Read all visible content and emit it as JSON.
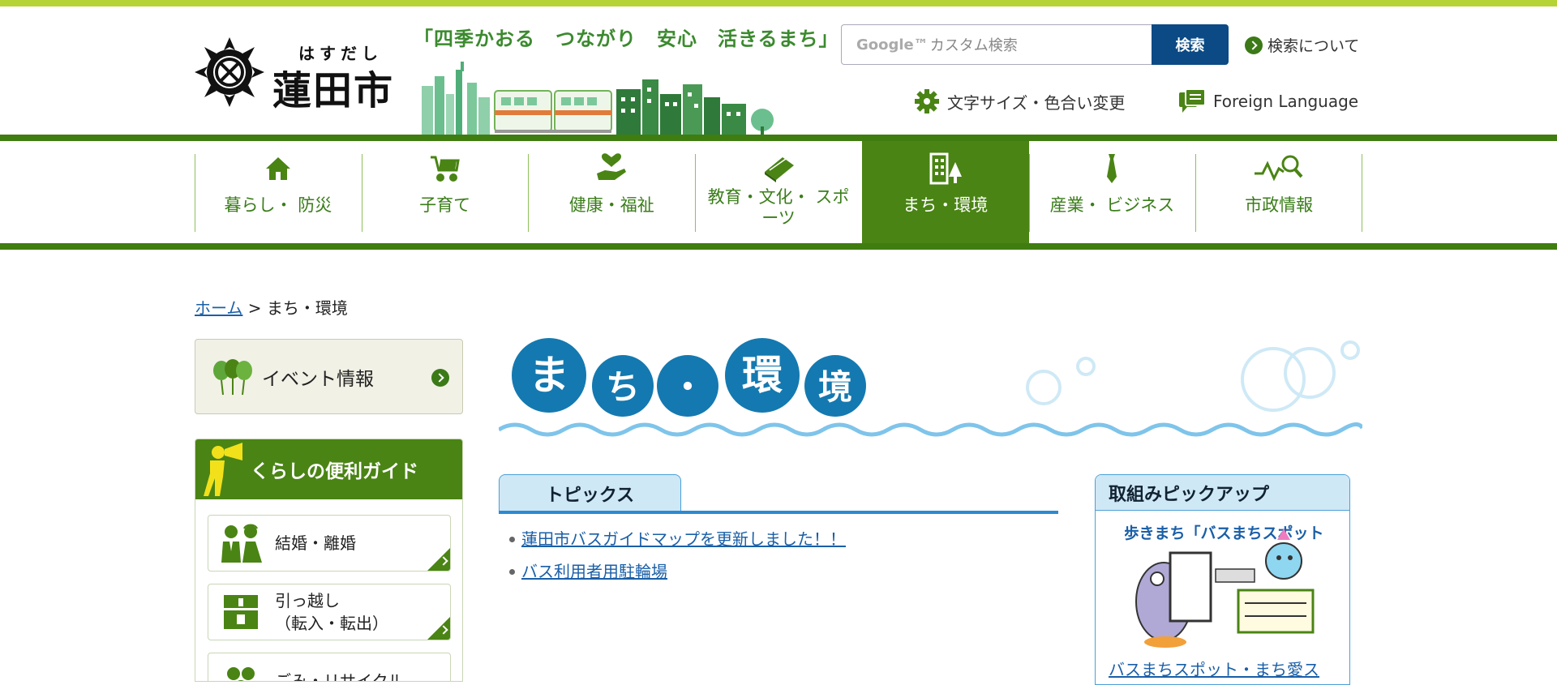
{
  "header": {
    "logo_kana": "はすだし",
    "logo_name": "蓮田市",
    "slogan": "「四季かおる　つながり　安心　活きるまち」",
    "search": {
      "placeholder_brand": "Google™",
      "placeholder_text": "カスタム検索",
      "button_label": "検索",
      "about_label": "検索について"
    },
    "textsize_label": "文字サイズ・色合い変更",
    "foreign_label": "Foreign Language"
  },
  "nav": {
    "items": [
      {
        "label": "暮らし・ 防災",
        "icon": "house-icon"
      },
      {
        "label": "子育て",
        "icon": "stroller-icon"
      },
      {
        "label": "健康・福祉",
        "icon": "heart-hand-icon"
      },
      {
        "label": "教育・文化・ スポーツ",
        "icon": "book-icon"
      },
      {
        "label": "まち・環境",
        "icon": "building-tree-icon",
        "active": true
      },
      {
        "label": "産業・ ビジネス",
        "icon": "necktie-icon"
      },
      {
        "label": "市政情報",
        "icon": "chart-magnifier-icon"
      }
    ]
  },
  "breadcrumb": {
    "home": "ホーム",
    "separator": ">",
    "current": "まち・環境"
  },
  "sidebar": {
    "event_label": "イベント情報",
    "guide_title": "くらしの便利ガイド",
    "guide_items": [
      {
        "label": "結婚・離婚"
      },
      {
        "label": "引っ越し",
        "sub": "（転入・転出）"
      },
      {
        "label": "ごみ・リサイクル"
      }
    ]
  },
  "main": {
    "title_chars": [
      "ま",
      "ち",
      "・",
      "環",
      "境"
    ],
    "topics_tab": "トピックス",
    "topics": [
      "蓮田市バスガイドマップを更新しました！！",
      "バス利用者用駐輪場"
    ],
    "pickup": {
      "title": "取組みピックアップ",
      "image_caption_top": "出歩きまち「バスまちスポット」",
      "link": "バスまちスポット・まち愛ス"
    }
  },
  "colors": {
    "brand_green": "#4a8414",
    "top_bar": "#b5d334",
    "search_button": "#0b4a84",
    "title_circle": "#1479b0",
    "link": "#1a5fa8"
  }
}
